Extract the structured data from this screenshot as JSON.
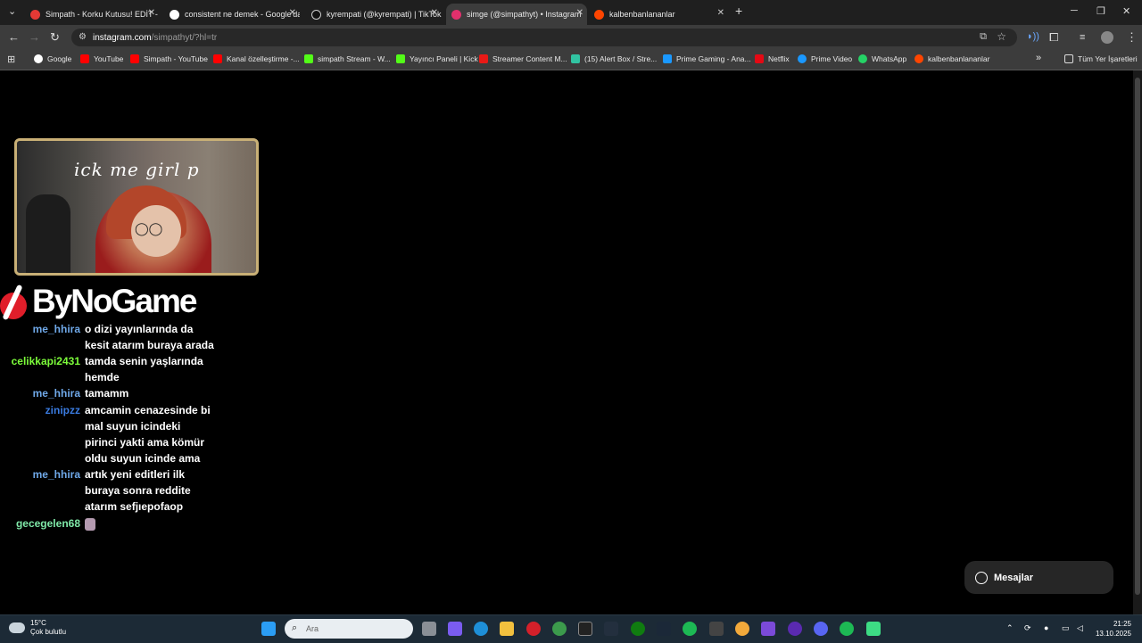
{
  "tabs": [
    {
      "title": "Simpath - Korku Kutusu! EDİT -",
      "favicon_color": "#e53935",
      "active": false
    },
    {
      "title": "consistent ne demek - Google'da",
      "favicon_color": "#ffffff",
      "active": false
    },
    {
      "title": "kyrempati (@kyrempati) | TikTok",
      "favicon_color": "#111111",
      "active": false
    },
    {
      "title": "simge (@simpathyt) • Instagram",
      "favicon_color": "#e1306c",
      "active": true
    },
    {
      "title": "kalbenbanlananlar",
      "favicon_color": "#ff4500",
      "active": false
    }
  ],
  "toolbar": {
    "url_host": "instagram.com",
    "url_rest": "/simpathyt/?hl=tr"
  },
  "bookmarks": [
    {
      "label": "Google",
      "color": "#ffffff"
    },
    {
      "label": "YouTube",
      "color": "#ff0000"
    },
    {
      "label": "Simpath - YouTube",
      "color": "#ff0000"
    },
    {
      "label": "Kanal özelleştirme -...",
      "color": "#ff0000"
    },
    {
      "label": "simpath Stream - W...",
      "color": "#53fc18"
    },
    {
      "label": "Yayıncı Paneli | Kick",
      "color": "#53fc18"
    },
    {
      "label": "Streamer Content M...",
      "color": "#e91916"
    },
    {
      "label": "(15) Alert Box / Stre...",
      "color": "#31c3a2"
    },
    {
      "label": "Prime Gaming - Ana...",
      "color": "#1a98ff"
    },
    {
      "label": "Netflix",
      "color": "#e50914"
    },
    {
      "label": "Prime Video",
      "color": "#1a98ff"
    },
    {
      "label": "WhatsApp",
      "color": "#25d366"
    },
    {
      "label": "kalbenbanlananlar",
      "color": "#ff4500"
    }
  ],
  "bookmarks_more": "»",
  "all_bookmarks": "Tüm Yer İşaretleri",
  "stream": {
    "overlay_text": "ick me girl p",
    "logo_text": "ByNoGame"
  },
  "chat": [
    {
      "user": "me_hhira",
      "color": "#6fa8e8",
      "text": "o dizi yayınlarında da kesit atarım buraya arada"
    },
    {
      "user": "celikkapi2431",
      "color": "#7cfc3a",
      "text": "tamda senin yaşlarında hemde"
    },
    {
      "user": "me_hhira",
      "color": "#6fa8e8",
      "text": "tamamm"
    },
    {
      "user": "zinipzz",
      "color": "#3a7be0",
      "text": "amcamin cenazesinde bi mal suyun icindeki pirinci yakti ama kömür oldu suyun icinde ama"
    },
    {
      "user": "me_hhira",
      "color": "#6fa8e8",
      "text": "artık yeni editleri ilk buraya sonra reddite atarım sefjıepofaop"
    },
    {
      "user": "gecegelen68",
      "color": "#7fe8a8",
      "text": ""
    }
  ],
  "messages_button": "Mesajlar",
  "taskbar": {
    "temperature": "15°C",
    "weather": "Çok bulutlu",
    "search_placeholder": "Ara",
    "time": "21:25",
    "date": "13.10.2025"
  }
}
